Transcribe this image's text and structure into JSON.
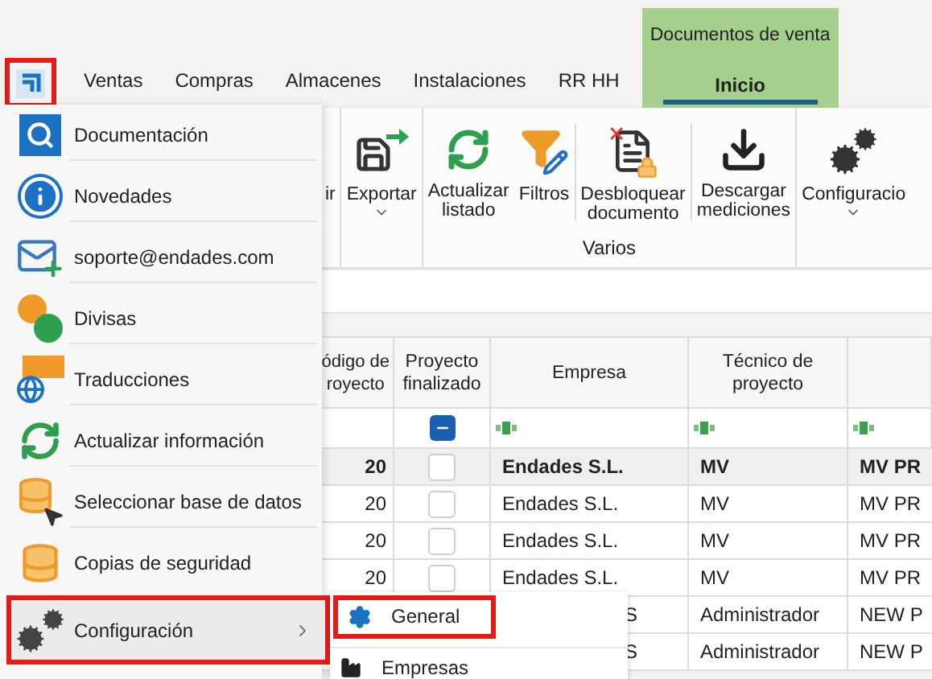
{
  "app_logo": {
    "highlighted": true
  },
  "tabs": [
    {
      "label": "Ventas",
      "selected": false
    },
    {
      "label": "Compras",
      "selected": false
    },
    {
      "label": "Almacenes",
      "selected": false
    },
    {
      "label": "Instalaciones",
      "selected": false
    },
    {
      "label": "RR HH",
      "selected": false
    }
  ],
  "context_tabs": {
    "title": "Documentos de venta",
    "tabs": [
      {
        "label": "Inicio",
        "selected": true
      }
    ]
  },
  "ribbon": {
    "groups": [
      {
        "buttons": [
          {
            "kind": "none",
            "label": "ir",
            "dropdown": false
          }
        ]
      },
      {
        "buttons": [
          {
            "kind": "export",
            "label": "Exportar",
            "dropdown": true
          }
        ]
      },
      {
        "title": "Varios",
        "buttons": [
          {
            "kind": "refresh",
            "label": "Actualizar listado",
            "dropdown": false
          },
          {
            "kind": "filter",
            "label": "Filtros",
            "dropdown": false
          },
          {
            "kind": "unlock",
            "label": "Desbloquear documento",
            "dropdown": false
          },
          {
            "kind": "download",
            "label": "Descargar mediciones",
            "dropdown": false
          }
        ]
      },
      {
        "buttons": [
          {
            "kind": "gears",
            "label": "Configuracio",
            "dropdown": true
          }
        ]
      }
    ]
  },
  "table": {
    "columns": [
      "ódigo de\nroyecto",
      "Proyecto\nfinalizado",
      "Empresa",
      "Técnico de\nproyecto",
      ""
    ],
    "filter_checkbox": {
      "indeterminate": true
    },
    "rows": [
      {
        "selected": true,
        "covered": false,
        "codigo": "20",
        "finalizado": false,
        "empresa": "Endades S.L.",
        "tecnico": "MV",
        "column_5": "MV PR"
      },
      {
        "selected": false,
        "covered": false,
        "codigo": "20",
        "finalizado": false,
        "empresa": "Endades S.L.",
        "tecnico": "MV",
        "column_5": "MV PR"
      },
      {
        "selected": false,
        "covered": false,
        "codigo": "20",
        "finalizado": false,
        "empresa": "Endades S.L.",
        "tecnico": "MV",
        "column_5": "MV PR"
      },
      {
        "selected": false,
        "covered": false,
        "codigo": "20",
        "finalizado": false,
        "empresa": "Endades S.L.",
        "tecnico": "MV",
        "column_5": "MV PR"
      },
      {
        "selected": false,
        "covered": true,
        "empresa": "S",
        "tecnico": "Administrador",
        "column_5": "NEW P"
      },
      {
        "selected": false,
        "covered": true,
        "empresa": "S",
        "tecnico": "Administrador",
        "column_5": "NEW P"
      }
    ]
  },
  "app_menu": {
    "items": [
      {
        "kind": "docs",
        "label": "Documentación",
        "selected": false,
        "submenu": false
      },
      {
        "kind": "info",
        "label": "Novedades",
        "selected": false,
        "submenu": false
      },
      {
        "kind": "mail",
        "label": "soporte@endades.com",
        "selected": false,
        "submenu": false
      },
      {
        "kind": "currency",
        "label": "Divisas",
        "selected": false,
        "submenu": false
      },
      {
        "kind": "translate",
        "label": "Traducciones",
        "selected": false,
        "submenu": false
      },
      {
        "kind": "refresh",
        "label": "Actualizar información",
        "selected": false,
        "submenu": false
      },
      {
        "kind": "database_select",
        "label": "Seleccionar base de datos",
        "selected": false,
        "submenu": false
      },
      {
        "kind": "database",
        "label": "Copias de seguridad",
        "selected": false,
        "submenu": false
      },
      {
        "kind": "gears",
        "label": "Configuración",
        "selected": true,
        "submenu": true
      }
    ]
  },
  "submenu": {
    "items": [
      {
        "kind": "gear",
        "label": "General",
        "selected": true
      },
      {
        "kind": "building",
        "label": "Empresas",
        "selected": false
      }
    ]
  }
}
